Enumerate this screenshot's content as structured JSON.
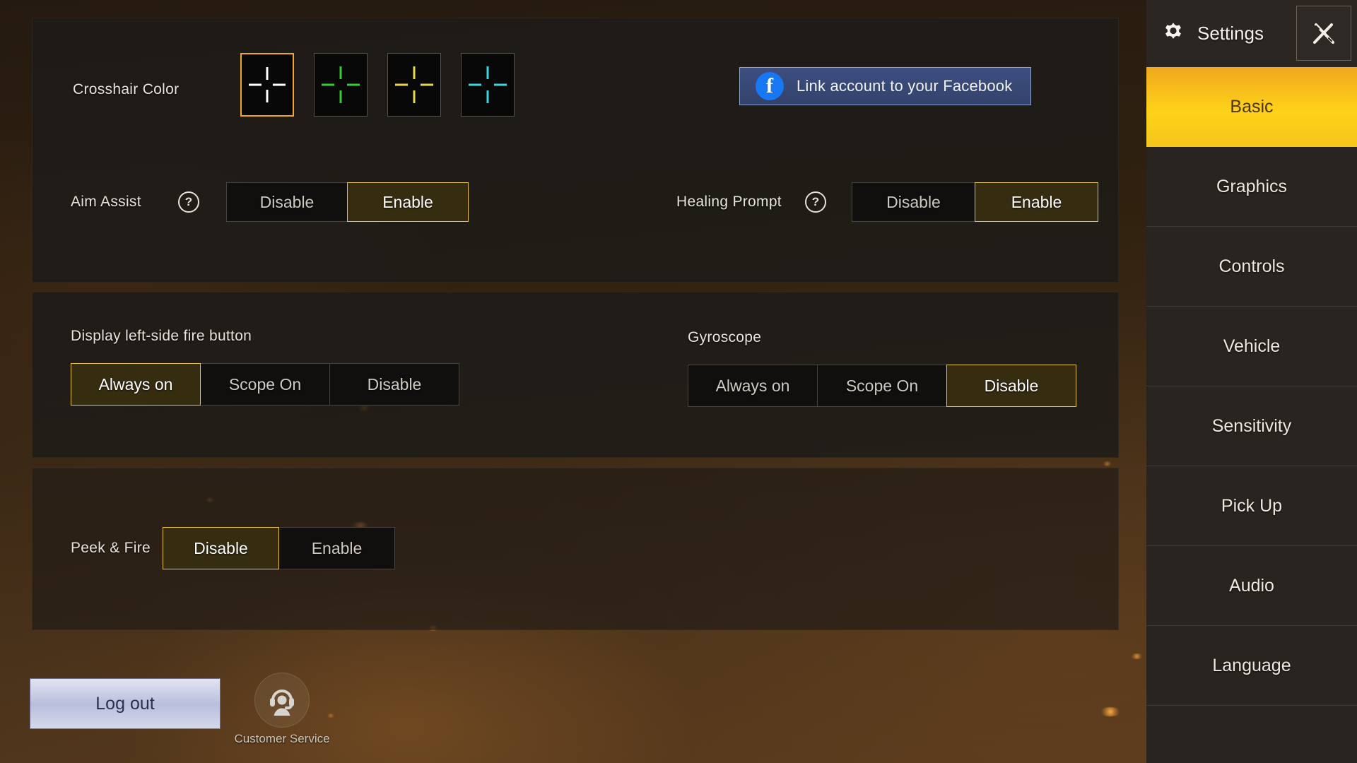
{
  "app": {
    "title": "Settings"
  },
  "header": {
    "gear_icon": "gear-icon",
    "title": "Settings",
    "close_icon": "close-icon"
  },
  "sidebar": {
    "items": [
      {
        "label": "Basic",
        "active": true
      },
      {
        "label": "Graphics",
        "active": false
      },
      {
        "label": "Controls",
        "active": false
      },
      {
        "label": "Vehicle",
        "active": false
      },
      {
        "label": "Sensitivity",
        "active": false
      },
      {
        "label": "Pick Up",
        "active": false
      },
      {
        "label": "Audio",
        "active": false
      },
      {
        "label": "Language",
        "active": false
      }
    ]
  },
  "crosshair": {
    "label": "Crosshair Color",
    "selected_index": 0,
    "options": [
      {
        "name": "white",
        "color": "#ffffff",
        "selected": true
      },
      {
        "name": "green",
        "color": "#33cc33",
        "selected": false
      },
      {
        "name": "yellow",
        "color": "#e6d84a",
        "selected": false
      },
      {
        "name": "cyan",
        "color": "#39d6e0",
        "selected": false
      }
    ]
  },
  "facebook": {
    "label": "Link account to your Facebook",
    "icon": "facebook-icon",
    "glyph": "f",
    "color": "#1877f2"
  },
  "aim_assist": {
    "label": "Aim Assist",
    "help_icon": "question-mark-icon",
    "options": [
      "Disable",
      "Enable"
    ],
    "selected": "Enable"
  },
  "healing_prompt": {
    "label": "Healing Prompt",
    "help_icon": "question-mark-icon",
    "options": [
      "Disable",
      "Enable"
    ],
    "selected": "Enable"
  },
  "fire_button": {
    "label": "Display left-side fire button",
    "options": [
      "Always on",
      "Scope On",
      "Disable"
    ],
    "selected": "Always on"
  },
  "gyroscope": {
    "label": "Gyroscope",
    "options": [
      "Always on",
      "Scope On",
      "Disable"
    ],
    "selected": "Disable"
  },
  "peek_fire": {
    "label": "Peek & Fire",
    "options": [
      "Disable",
      "Enable"
    ],
    "selected": "Disable"
  },
  "bottom": {
    "logout_label": "Log out",
    "customer_service_label": "Customer Service",
    "customer_service_icon": "headset-support-icon"
  },
  "colors": {
    "accent": "#f0a81e",
    "accent_bright": "#ffd21a",
    "selected_border": "#e8c43c",
    "panel_bg": "#1e1b18",
    "sidebar_bg": "#29241f",
    "facebook_blue": "#1877f2",
    "logout_bg": "#b9bedd"
  }
}
